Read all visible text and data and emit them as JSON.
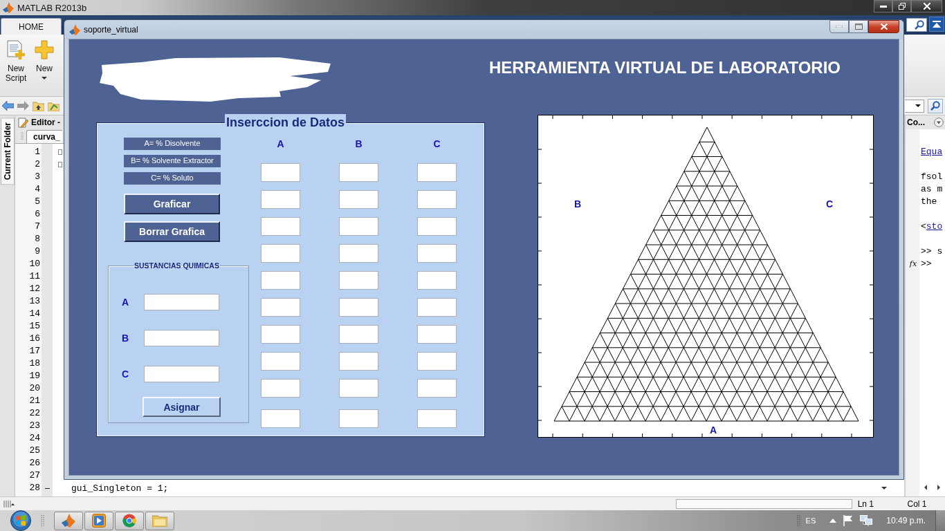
{
  "matlab": {
    "title": "MATLAB R2013b",
    "tabs": [
      {
        "label": "HOME",
        "selected": true
      }
    ],
    "toolstrip_buttons": [
      {
        "kind": "new_script",
        "label_lines": [
          "New",
          "Script"
        ],
        "dropdown": false
      },
      {
        "kind": "new",
        "label_lines": [
          "New"
        ],
        "dropdown": true
      }
    ],
    "side_tab": "Current Folder",
    "editor": {
      "title": "Editor -",
      "tab": "curva_",
      "rows": [
        {
          "number": "1",
          "fold": true,
          "executable": false
        },
        {
          "number": "2",
          "fold": true,
          "executable": false
        },
        {
          "number": "3",
          "fold": false,
          "executable": false
        },
        {
          "number": "4",
          "fold": false,
          "executable": false
        },
        {
          "number": "5",
          "fold": false,
          "executable": false
        },
        {
          "number": "6",
          "fold": false,
          "executable": false
        },
        {
          "number": "7",
          "fold": false,
          "executable": false
        },
        {
          "number": "8",
          "fold": false,
          "executable": false
        },
        {
          "number": "9",
          "fold": false,
          "executable": false
        },
        {
          "number": "10",
          "fold": false,
          "executable": false
        },
        {
          "number": "11",
          "fold": false,
          "executable": false
        },
        {
          "number": "12",
          "fold": false,
          "executable": false
        },
        {
          "number": "13",
          "fold": false,
          "executable": false
        },
        {
          "number": "14",
          "fold": false,
          "executable": false
        },
        {
          "number": "15",
          "fold": false,
          "executable": false
        },
        {
          "number": "16",
          "fold": false,
          "executable": false
        },
        {
          "number": "17",
          "fold": false,
          "executable": false
        },
        {
          "number": "18",
          "fold": false,
          "executable": false
        },
        {
          "number": "19",
          "fold": false,
          "executable": false
        },
        {
          "number": "20",
          "fold": false,
          "executable": false
        },
        {
          "number": "21",
          "fold": false,
          "executable": false
        },
        {
          "number": "22",
          "fold": false,
          "executable": false
        },
        {
          "number": "23",
          "fold": false,
          "executable": false
        },
        {
          "number": "24",
          "fold": false,
          "executable": false
        },
        {
          "number": "25",
          "fold": false,
          "executable": false
        },
        {
          "number": "26",
          "fold": false,
          "executable": false
        },
        {
          "number": "27",
          "fold": false,
          "executable": false
        },
        {
          "number": "28",
          "fold": false,
          "executable": true,
          "code": "gui_Singleton = 1;"
        }
      ]
    },
    "command_window": {
      "title": "Co...",
      "blocks": [
        {
          "lines": [
            {
              "kind": "link",
              "text": "Equa"
            }
          ]
        },
        {
          "lines": [
            {
              "kind": "text",
              "text": "fsol"
            },
            {
              "kind": "text",
              "text": "as m"
            },
            {
              "kind": "text",
              "text": "the"
            }
          ]
        },
        {
          "lines": [
            {
              "kind": "link",
              "prefix": "<",
              "text": "sto"
            }
          ]
        },
        {
          "lines": [
            {
              "kind": "text",
              "text": ">> s"
            },
            {
              "kind": "prompt",
              "marker": "fx",
              "text": ">>"
            }
          ]
        }
      ]
    },
    "status_bar": {
      "line": "Ln 1",
      "column": "Col 1"
    }
  },
  "figure": {
    "title": "soporte_virtual",
    "heading": "HERRAMIENTA VIRTUAL DE LABORATORIO",
    "data_panel": {
      "title": "Inserccion de Datos",
      "legend": [
        "A= % Disolvente",
        "B= % Solvente Extractor",
        "C= % Soluto"
      ],
      "buttons": [
        "Graficar",
        "Borrar Grafica"
      ],
      "substances": {
        "title": "SUSTANCIAS QUIMICAS",
        "fields": [
          {
            "label": "A"
          },
          {
            "label": "B"
          },
          {
            "label": "C"
          }
        ],
        "button": "Asignar"
      },
      "columns": [
        {
          "header": "A"
        },
        {
          "header": "B"
        },
        {
          "header": "C"
        }
      ]
    },
    "plot": {
      "labels": [
        "B",
        "C",
        "A"
      ]
    }
  },
  "taskbar": {
    "language": "ES",
    "clock": "10:49 p.m."
  }
}
